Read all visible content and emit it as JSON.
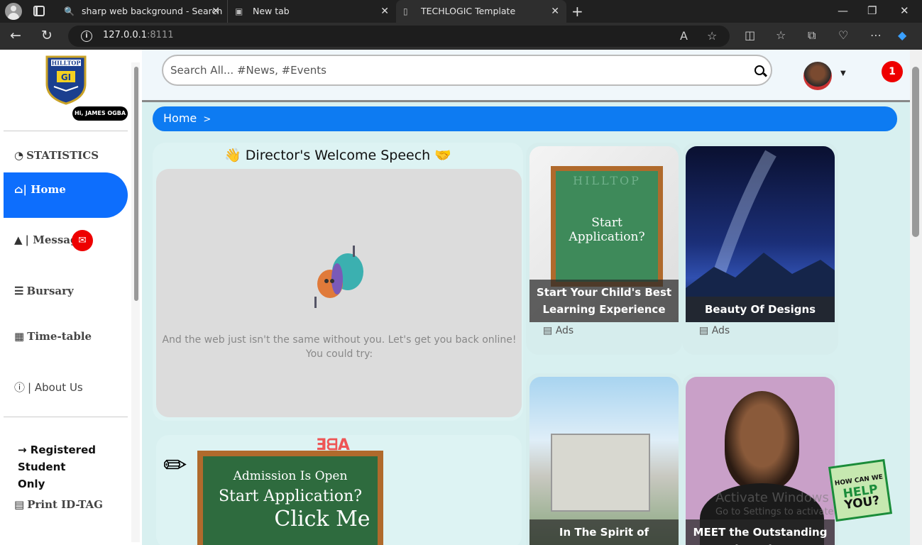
{
  "browser": {
    "tabs": [
      {
        "label": "sharp web background - Search",
        "icon": "search-icon"
      },
      {
        "label": "New tab",
        "icon": "newtab-icon"
      },
      {
        "label": "TECHLOGIC Template",
        "icon": "document-icon"
      }
    ],
    "url_host": "127.0.0.1",
    "url_port": ":8111"
  },
  "sidebar": {
    "greeting": "Hi, JAMES OGBA",
    "logo_text": "HILLTOP",
    "items": [
      {
        "label": "STATISTICS",
        "icon": "dashboard-icon"
      },
      {
        "label": "| Home",
        "icon": "home-icon"
      },
      {
        "label": "| Message",
        "icon": "bell-icon"
      },
      {
        "label": "Bursary",
        "icon": "list-icon"
      },
      {
        "label": "Time-table",
        "icon": "calendar-icon"
      },
      {
        "label": "| About Us",
        "icon": "info-icon"
      }
    ],
    "registered": "→ Registered Student Only",
    "print": "Print ID-TAG"
  },
  "header": {
    "search_placeholder": "Search All...  #News, #Events",
    "notification_count": "1"
  },
  "breadcrumb": {
    "label": "Home",
    "sep": ">"
  },
  "director": {
    "title": "Director's Welcome Speech",
    "offline_text": "And the web just isn't the same without you. Let's get you back online! You could try:"
  },
  "admission": {
    "line1": "Admission Is Open",
    "line2": "Start Application?",
    "line3": "Click Me"
  },
  "cards": [
    {
      "caption": "Start Your Child's Best Learning Experience",
      "tag": "Ads",
      "board_text": "Start Application?",
      "board_header": "HILLTOP"
    },
    {
      "caption": "Beauty Of Designs",
      "tag": "Ads"
    },
    {
      "caption": "In The Spirit of ONENESS"
    },
    {
      "caption": "MEET the Outstanding Champions"
    }
  ],
  "help": {
    "line1": "HOW CAN WE",
    "line2": "HELP",
    "line3": "YOU?"
  },
  "watermark": {
    "line1": "Activate Windows",
    "line2": "Go to Settings to activate Windows."
  }
}
